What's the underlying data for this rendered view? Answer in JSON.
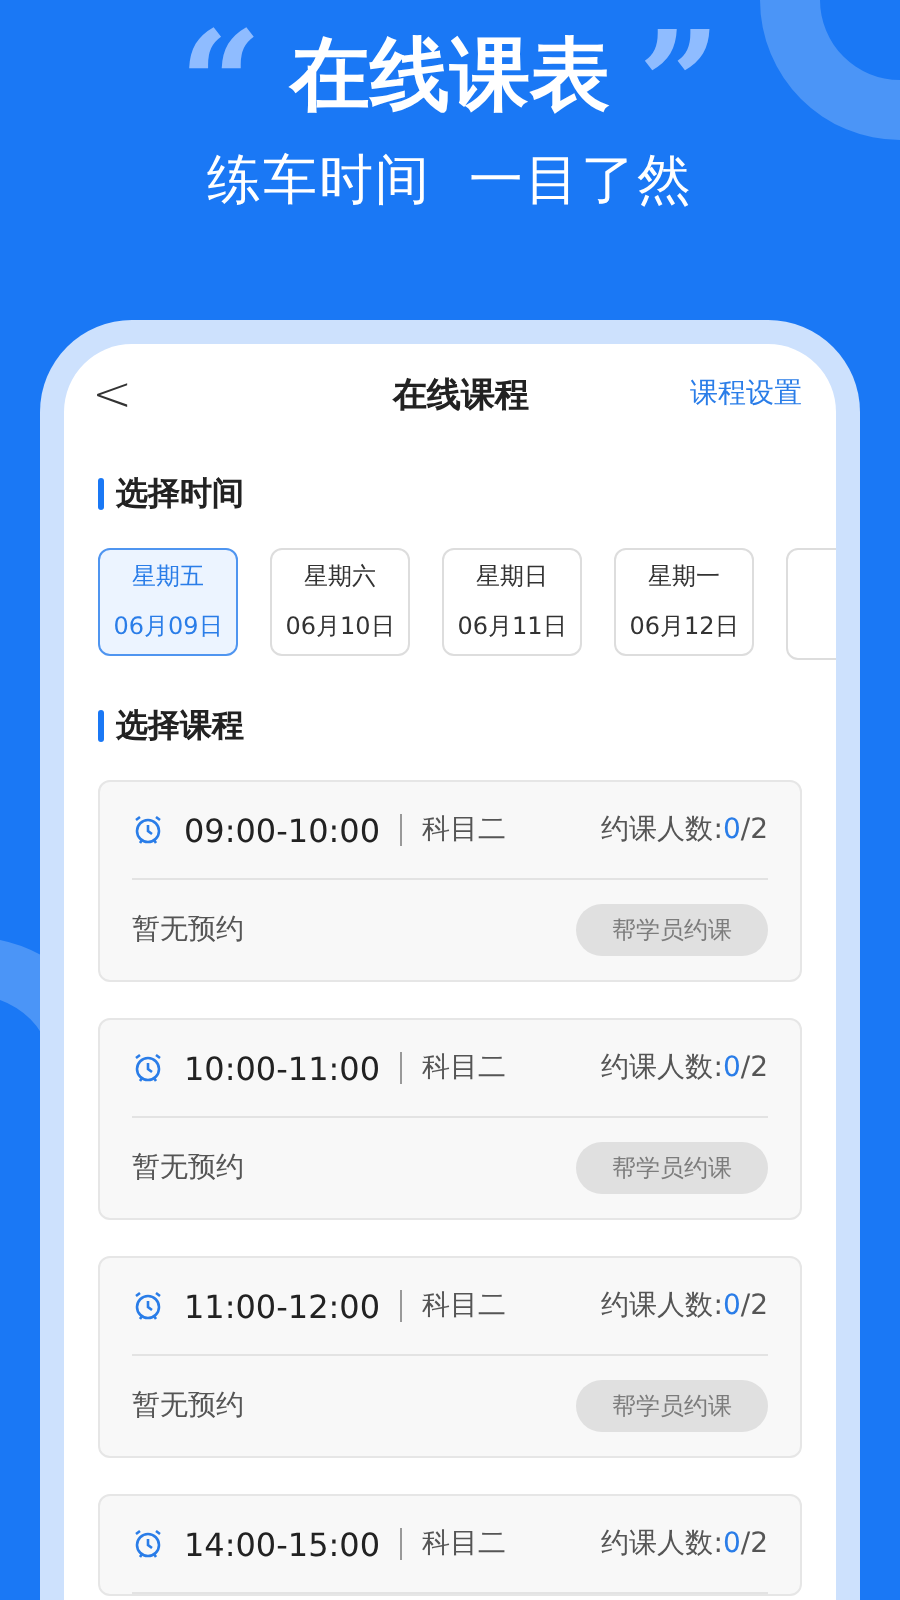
{
  "banner": {
    "title": "在线课表",
    "open_quote": "“",
    "close_quote": "”",
    "subtitle": "练车时间  一目了然"
  },
  "nav": {
    "back": "<",
    "title": "在线课程",
    "action": "课程设置"
  },
  "date_section": {
    "title": "选择时间"
  },
  "dates": [
    {
      "weekday": "星期五",
      "date": "06月09日",
      "selected": true
    },
    {
      "weekday": "星期六",
      "date": "06月10日",
      "selected": false
    },
    {
      "weekday": "星期日",
      "date": "06月11日",
      "selected": false
    },
    {
      "weekday": "星期一",
      "date": "06月12日",
      "selected": false
    }
  ],
  "course_section": {
    "title": "选择课程"
  },
  "courses": [
    {
      "time": "09:00-10:00",
      "subject": "科目二",
      "count_label": "约课人数:",
      "booked": "0",
      "capacity": "/2",
      "status": "暂无预约",
      "button": {
        "label": "帮学员约课",
        "disabled": true
      }
    },
    {
      "time": "10:00-11:00",
      "subject": "科目二",
      "count_label": "约课人数:",
      "booked": "0",
      "capacity": "/2",
      "status": "暂无预约",
      "button": {
        "label": "帮学员约课",
        "disabled": true
      }
    },
    {
      "time": "11:00-12:00",
      "subject": "科目二",
      "count_label": "约课人数:",
      "booked": "0",
      "capacity": "/2",
      "status": "暂无预约",
      "button": {
        "label": "帮学员约课",
        "disabled": true
      }
    },
    {
      "time": "14:00-15:00",
      "subject": "科目二",
      "count_label": "约课人数:",
      "booked": "0",
      "capacity": "/2"
    }
  ]
}
